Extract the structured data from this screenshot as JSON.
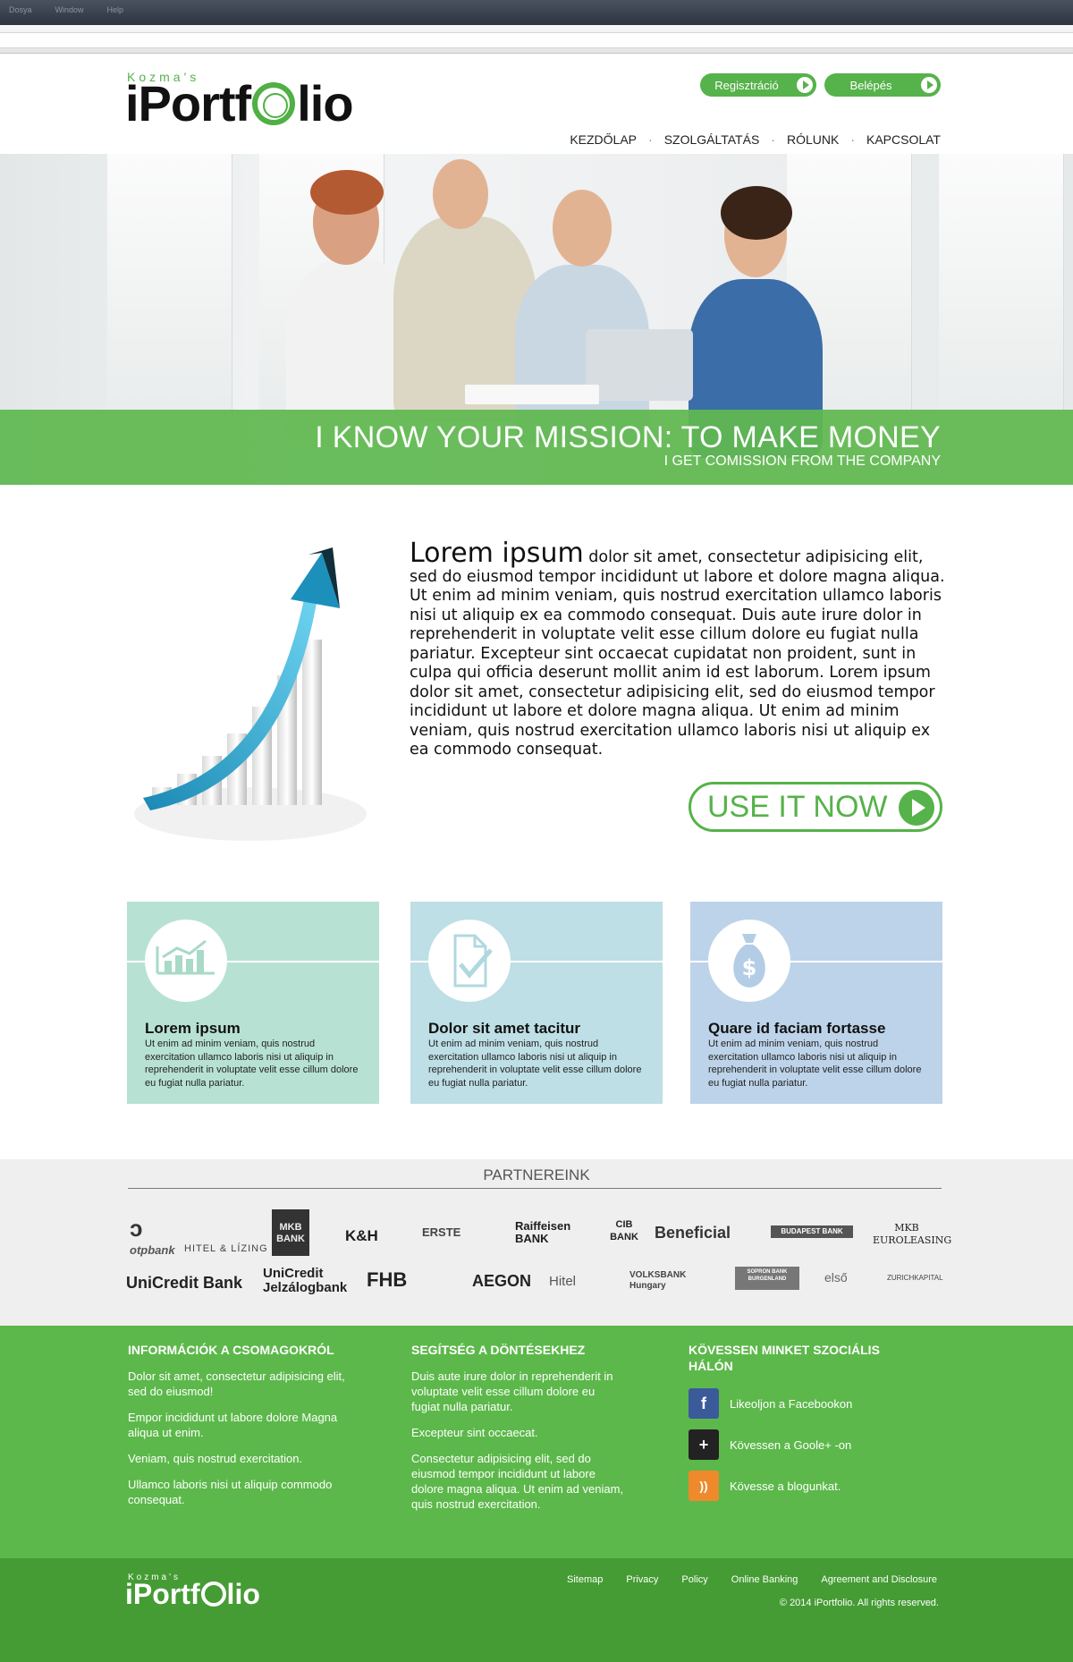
{
  "browser": {
    "menu": [
      "Dosya",
      "Window",
      "Help"
    ]
  },
  "header": {
    "logo_small": "Kozma's",
    "logo_left": "iPortf",
    "logo_right": "lio",
    "register_label": "Regisztráció",
    "login_label": "Belépés",
    "nav": [
      "KEZDŐLAP",
      "SZOLGÁLTATÁS",
      "RÓLUNK",
      "KAPCSOLAT"
    ]
  },
  "hero": {
    "title": "I KNOW YOUR MISSION: TO MAKE MONEY",
    "subtitle": "I GET COMISSION FROM THE COMPANY"
  },
  "intro": {
    "lead": "Lorem ipsum",
    "body": " dolor sit amet, consectetur adipisicing elit, sed do eiusmod tempor incididunt ut labore et dolore magna aliqua. Ut enim ad minim veniam, quis nostrud exercitation ullamco laboris nisi ut aliquip ex ea commodo consequat. Duis aute irure dolor in reprehenderit in voluptate velit esse cillum dolore eu fugiat nulla pariatur. Excepteur sint occaecat cupidatat non proident, sunt in culpa qui officia deserunt mollit anim id est laborum. Lorem ipsum dolor sit amet, consectetur adipisicing elit, sed do eiusmod tempor incididunt ut labore et dolore magna aliqua. Ut enim ad minim veniam, quis nostrud exercitation ullamco laboris nisi ut aliquip ex ea commodo consequat.",
    "cta": "USE IT NOW"
  },
  "cards": [
    {
      "title": "Lorem ipsum",
      "text": "Ut enim ad minim veniam, quis nostrud exercitation ullamco laboris nisi ut aliquip in reprehenderit in voluptate velit esse cillum dolore eu fugiat nulla pariatur.",
      "icon": "chart-icon",
      "color": "#b7e2d3"
    },
    {
      "title": "Dolor sit amet tacitur",
      "text": "Ut enim ad minim veniam, quis nostrud exercitation ullamco laboris nisi ut aliquip in reprehenderit in voluptate velit esse cillum dolore eu fugiat nulla pariatur.",
      "icon": "document-check-icon",
      "color": "#bddfe5"
    },
    {
      "title": "Quare id faciam fortasse",
      "text": "Ut enim ad minim veniam, quis nostrud exercitation ullamco laboris nisi ut aliquip in reprehenderit in voluptate velit esse cillum dolore eu fugiat nulla pariatur.",
      "icon": "money-bag-icon",
      "color": "#bdd3e9"
    }
  ],
  "partners": {
    "title": "PARTNEREINK",
    "row1": [
      "otpbank",
      "HITEL & LÍZING",
      "MKB BANK",
      "K&H",
      "ERSTE",
      "Raiffeisen BANK",
      "CIB BANK",
      "Beneficial",
      "BUDAPEST BANK",
      "MKB EUROLEASING"
    ],
    "row2": [
      "UniCredit Bank",
      "UniCredit Jelzálogbank",
      "FHB",
      "AEGON",
      "Hitel",
      "VOLKSBANK Hungary",
      "SOPRON BANK BURGENLAND",
      "első",
      "ZURICHKAPITAL"
    ]
  },
  "footer": {
    "col1": {
      "title": "INFORMÁCIÓK A CSOMAGOKRÓL",
      "items": [
        "Dolor sit amet, consectetur adipisicing elit, sed do eiusmod!",
        "Empor incididunt ut labore dolore Magna aliqua ut enim.",
        "Veniam, quis nostrud exercitation.",
        "Ullamco laboris nisi ut aliquip commodo consequat."
      ]
    },
    "col2": {
      "title": "SEGÍTSÉG A DÖNTÉSEKHEZ",
      "items": [
        "Duis aute irure dolor in reprehenderit  in voluptate velit esse cillum dolore eu fugiat nulla pariatur.",
        "Excepteur sint occaecat.",
        "Consectetur adipisicing elit, sed do eiusmod tempor incididunt ut labore dolore magna aliqua. Ut enim ad  veniam, quis nostrud exercitation."
      ]
    },
    "col3": {
      "title": "KÖVESSEN MINKET SZOCIÁLIS HÁLÓN",
      "items": [
        "Likeoljon a Facebookon",
        "Kövessen a Goole+ -on",
        "Kövesse a blogunkat."
      ]
    },
    "links": [
      "Sitemap",
      "Privacy",
      "Policy",
      "Online Banking",
      "Agreement and Disclosure"
    ],
    "copyright": "© 2014  iPortfolio. All rights reserved."
  }
}
